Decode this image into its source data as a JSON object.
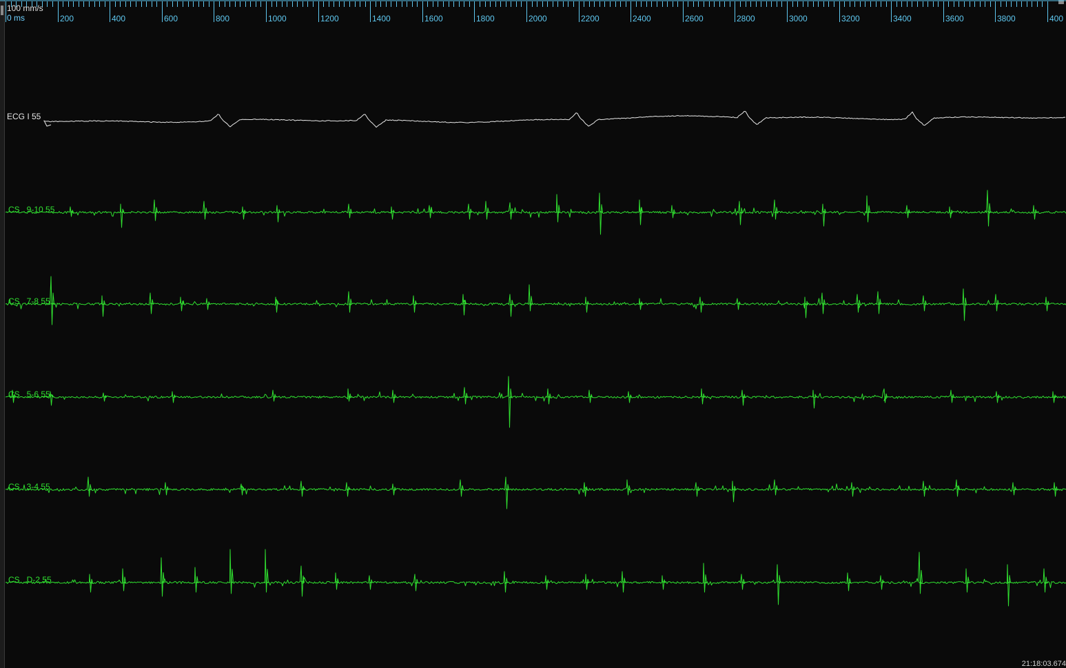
{
  "header": {
    "speed": "100 mm/s",
    "origin_label": "0 ms"
  },
  "ruler": {
    "color": "#5fc8f0",
    "major_labels": [
      "200",
      "400",
      "600",
      "800",
      "1000",
      "1200",
      "1400",
      "1600",
      "1800",
      "2000",
      "2200",
      "2400",
      "2600",
      "2800",
      "3000",
      "3200",
      "3400",
      "3600",
      "3800",
      "400"
    ]
  },
  "channels": [
    {
      "id": "ecg-i",
      "label": "ECG I 55",
      "color": "#e8e8e8",
      "kind": "surface"
    },
    {
      "id": "cs-9-10",
      "label": "CS   9-10 55",
      "color": "#30e030",
      "kind": "intracardiac"
    },
    {
      "id": "cs-7-8",
      "label": "CS   7-8 55",
      "color": "#30e030",
      "kind": "intracardiac"
    },
    {
      "id": "cs-5-6",
      "label": "CS   5-6 55",
      "color": "#30e030",
      "kind": "intracardiac"
    },
    {
      "id": "cs-3-4",
      "label": "CS   3-4 55",
      "color": "#30e030",
      "kind": "intracardiac"
    },
    {
      "id": "cs-d-2",
      "label": "CS   D-2 55",
      "color": "#30e030",
      "kind": "intracardiac"
    }
  ],
  "status": {
    "timestamp": "21:18:03.674"
  }
}
